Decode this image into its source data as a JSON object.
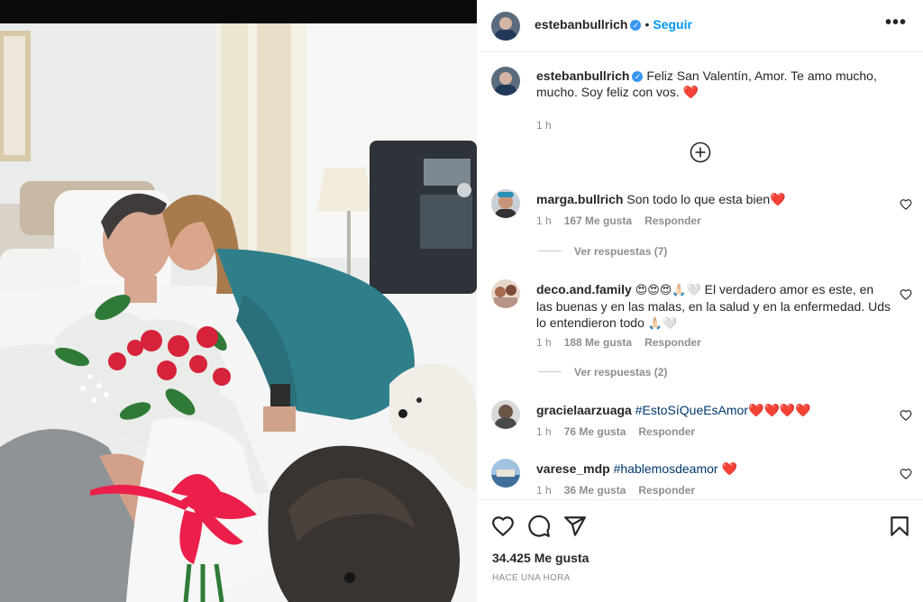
{
  "post": {
    "author": "estebanbullrich",
    "follow_label": "Seguir",
    "more_label": "•••",
    "caption": "Feliz San Valentín, Amor. Te amo mucho, mucho. Soy feliz con vos.",
    "caption_heart": "❤️",
    "caption_time": "1 h"
  },
  "comments": [
    {
      "user": "marga.bullrich",
      "text": "Son todo lo que esta bien",
      "emoji": "❤️",
      "time": "1 h",
      "likes": "167 Me gusta",
      "reply": "Responder",
      "view_replies": "Ver respuestas (7)"
    },
    {
      "user": "deco.and.family",
      "emoji_prefix": "😍😍😍🙏🏻🤍",
      "text": "El verdadero amor es este, en las buenas y en las malas, en la salud y en la enfermedad. Uds lo entendieron todo",
      "emoji": "🙏🏻🤍",
      "time": "1 h",
      "likes": "188 Me gusta",
      "reply": "Responder",
      "view_replies": "Ver respuestas (2)"
    },
    {
      "user": "gracielaarzuaga",
      "text": "#EstoSíQueEsAmor",
      "emoji": "❤️❤️❤️❤️",
      "time": "1 h",
      "likes": "76 Me gusta",
      "reply": "Responder"
    },
    {
      "user": "varese_mdp",
      "text": "#hablemosdeamor",
      "emoji": "❤️",
      "time": "1 h",
      "likes": "36 Me gusta",
      "reply": "Responder"
    }
  ],
  "footer": {
    "likes_count": "34.425 Me gusta",
    "posted_when": "HACE UNA HORA"
  },
  "icons": {
    "like": "heart-outline-icon",
    "comment": "comment-bubble-icon",
    "share": "paper-plane-icon",
    "save": "bookmark-icon",
    "load_more": "plus-circle-icon",
    "verified": "verified-badge-icon"
  },
  "colors": {
    "link_blue": "#0095f6",
    "hashtag": "#00376b",
    "secondary_text": "#8e8e8e",
    "heart_red": "#ed1c3a"
  }
}
